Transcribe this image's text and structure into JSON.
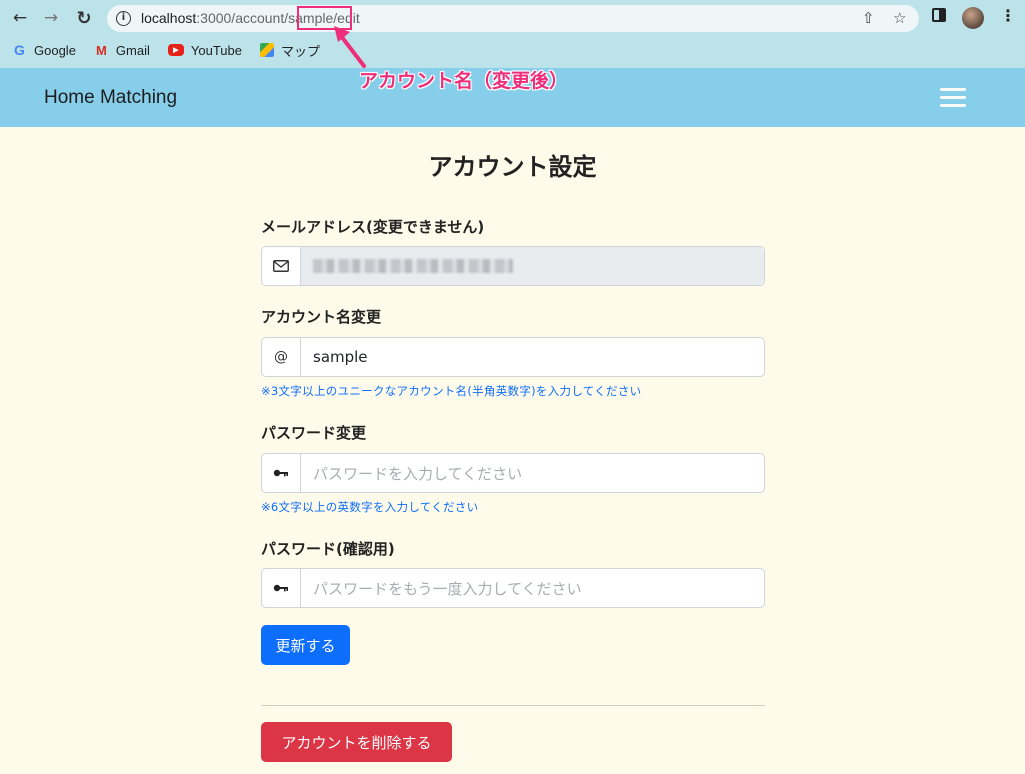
{
  "browser": {
    "url_host": "localhost",
    "url_path_before": ":3000/account/",
    "url_highlight": "sample",
    "url_path_after": "/edit",
    "bookmarks": [
      {
        "label": "Google",
        "icon": "google-icon"
      },
      {
        "label": "Gmail",
        "icon": "gmail-icon"
      },
      {
        "label": "YouTube",
        "icon": "youtube-icon"
      },
      {
        "label": "マップ",
        "icon": "maps-icon"
      }
    ]
  },
  "annotation": {
    "label": "アカウント名（変更後）",
    "color": "#ee2e7b"
  },
  "navbar": {
    "brand": "Home Matching",
    "background": "#87ceeb"
  },
  "page": {
    "title": "アカウント設定"
  },
  "form": {
    "email": {
      "label": "メールアドレス(変更できません)",
      "icon": "envelope-icon"
    },
    "account_name": {
      "label": "アカウント名変更",
      "prefix": "@",
      "value": "sample",
      "help": "※3文字以上のユニークなアカウント名(半角英数字)を入力してください"
    },
    "password": {
      "label": "パスワード変更",
      "icon": "key-icon",
      "placeholder": "パスワードを入力してください",
      "help": "※6文字以上の英数字を入力してください"
    },
    "password_confirm": {
      "label": "パスワード(確認用)",
      "icon": "key-icon",
      "placeholder": "パスワードをもう一度入力してください"
    },
    "submit_label": "更新する",
    "delete_label": "アカウントを削除する"
  },
  "colors": {
    "primary": "#0d6efd",
    "danger": "#dc3545",
    "page_bg": "#fffbea"
  }
}
